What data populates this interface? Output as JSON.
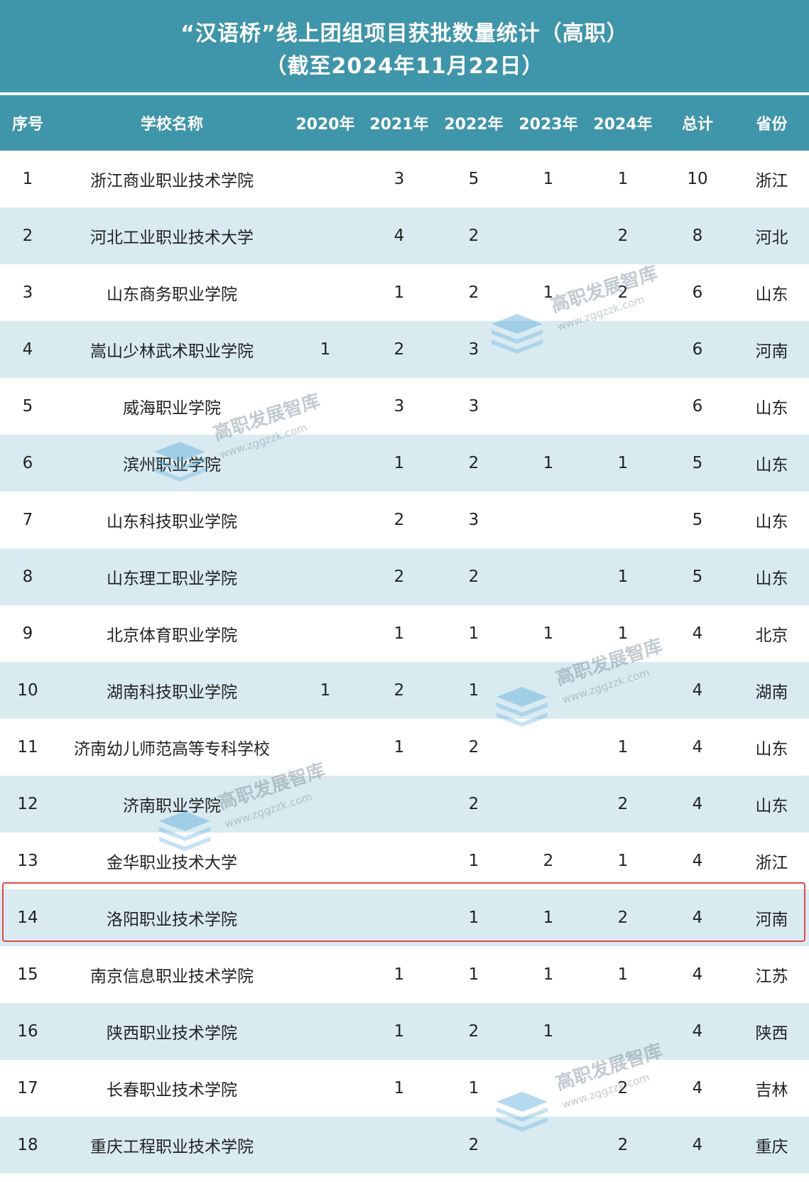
{
  "title": {
    "line1": "“汉语桥”线上团组项目获批数量统计（高职）",
    "line2": "（截至2024年11月22日）"
  },
  "columns": [
    "序号",
    "学校名称",
    "2020年",
    "2021年",
    "2022年",
    "2023年",
    "2024年",
    "总计",
    "省份"
  ],
  "rows": [
    [
      "1",
      "浙江商业职业技术学院",
      "",
      "3",
      "5",
      "1",
      "1",
      "10",
      "浙江"
    ],
    [
      "2",
      "河北工业职业技术大学",
      "",
      "4",
      "2",
      "",
      "2",
      "8",
      "河北"
    ],
    [
      "3",
      "山东商务职业学院",
      "",
      "1",
      "2",
      "1",
      "2",
      "6",
      "山东"
    ],
    [
      "4",
      "嵩山少林武术职业学院",
      "1",
      "2",
      "3",
      "",
      "",
      "6",
      "河南"
    ],
    [
      "5",
      "威海职业学院",
      "",
      "3",
      "3",
      "",
      "",
      "6",
      "山东"
    ],
    [
      "6",
      "滨州职业学院",
      "",
      "1",
      "2",
      "1",
      "1",
      "5",
      "山东"
    ],
    [
      "7",
      "山东科技职业学院",
      "",
      "2",
      "3",
      "",
      "",
      "5",
      "山东"
    ],
    [
      "8",
      "山东理工职业学院",
      "",
      "2",
      "2",
      "",
      "1",
      "5",
      "山东"
    ],
    [
      "9",
      "北京体育职业学院",
      "",
      "1",
      "1",
      "1",
      "1",
      "4",
      "北京"
    ],
    [
      "10",
      "湖南科技职业学院",
      "1",
      "2",
      "1",
      "",
      "",
      "4",
      "湖南"
    ],
    [
      "11",
      "济南幼儿师范高等专科学校",
      "",
      "1",
      "2",
      "",
      "1",
      "4",
      "山东"
    ],
    [
      "12",
      "济南职业学院",
      "",
      "",
      "2",
      "",
      "2",
      "4",
      "山东"
    ],
    [
      "13",
      "金华职业技术大学",
      "",
      "",
      "1",
      "2",
      "1",
      "4",
      "浙江"
    ],
    [
      "14",
      "洛阳职业技术学院",
      "",
      "",
      "1",
      "1",
      "2",
      "4",
      "河南"
    ],
    [
      "15",
      "南京信息职业技术学院",
      "",
      "1",
      "1",
      "1",
      "1",
      "4",
      "江苏"
    ],
    [
      "16",
      "陕西职业技术学院",
      "",
      "1",
      "2",
      "1",
      "",
      "4",
      "陕西"
    ],
    [
      "17",
      "长春职业技术学院",
      "",
      "1",
      "1",
      "",
      "2",
      "4",
      "吉林"
    ],
    [
      "18",
      "重庆工程职业技术学院",
      "",
      "",
      "2",
      "",
      "2",
      "4",
      "重庆"
    ]
  ],
  "highlighted_row": "14",
  "watermark": {
    "text": "高职发展智库",
    "url": "www.zggzzk.com"
  },
  "colors": {
    "header_bg": "#3f95a9",
    "stripe": "#d9ebf1",
    "highlight_border": "#e0474a"
  }
}
